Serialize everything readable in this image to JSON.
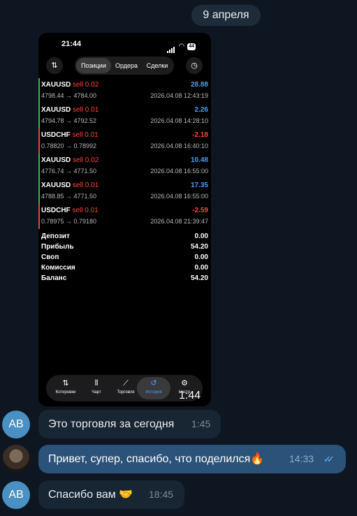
{
  "date_label": "9 апреля",
  "phone": {
    "status_time": "21:44",
    "battery": "44",
    "tabs": [
      "Позиции",
      "Ордера",
      "Сделки"
    ],
    "trades": [
      {
        "symbol": "XAUUSD",
        "side": "sell 0.02",
        "prices": "4798.44 → 4784.00",
        "profit": "28.88",
        "time": "2026.04.08 12:43:19",
        "positive": true
      },
      {
        "symbol": "XAUUSD",
        "side": "sell 0.01",
        "prices": "4794.78 → 4792.52",
        "profit": "2.26",
        "time": "2026.04.08 14:28:10",
        "positive": true
      },
      {
        "symbol": "USDCHF",
        "side": "sell 0.01",
        "prices": "0.78820 → 0.78992",
        "profit": "-2.18",
        "time": "2026.04.08 16:40:10",
        "positive": false
      },
      {
        "symbol": "XAUUSD",
        "side": "sell 0.02",
        "prices": "4776.74 → 4771.50",
        "profit": "10.48",
        "time": "2026.04.08 16:55:00",
        "positive": true
      },
      {
        "symbol": "XAUUSD",
        "side": "sell 0.01",
        "prices": "4788.85 → 4771.50",
        "profit": "17.35",
        "time": "2026.04.08 16:55:00",
        "positive": true
      },
      {
        "symbol": "USDCHF",
        "side": "sell 0.01",
        "prices": "0.78975 → 0.79180",
        "profit": "-2.59",
        "time": "2026.04.08 21:39:47",
        "positive": false
      }
    ],
    "summary": [
      {
        "label": "Депозит",
        "value": "0.00"
      },
      {
        "label": "Прибыль",
        "value": "54.20"
      },
      {
        "label": "Своп",
        "value": "0.00"
      },
      {
        "label": "Комиссия",
        "value": "0.00"
      },
      {
        "label": "Баланс",
        "value": "54.20"
      }
    ],
    "bottom_tabs": [
      {
        "icon": "⇅",
        "label": "Котировки",
        "icon_name": "quotes-icon"
      },
      {
        "icon": "⫴",
        "label": "Чарт",
        "icon_name": "chart-candles-icon"
      },
      {
        "icon": "⟋",
        "label": "Торговля",
        "icon_name": "trade-icon"
      },
      {
        "icon": "↺",
        "label": "История",
        "icon_name": "history-icon"
      },
      {
        "icon": "⚙",
        "label": "Настр",
        "icon_name": "settings-icon"
      }
    ],
    "video_time": "1:44",
    "colors": {
      "profit": "#4a9eff",
      "loss": "#ff453a",
      "bar_profit": "#30b94a",
      "bar_loss": "#e5483d"
    }
  },
  "messages": [
    {
      "avatar": "AB",
      "text": "Это торговля за сегодня",
      "time": "1:45"
    },
    {
      "text": "Привет, супер, спасибо, что поделился🔥",
      "time": "14:33"
    },
    {
      "avatar": "AB",
      "text": "Спасибо вам 🤝",
      "time": "18:45"
    }
  ]
}
